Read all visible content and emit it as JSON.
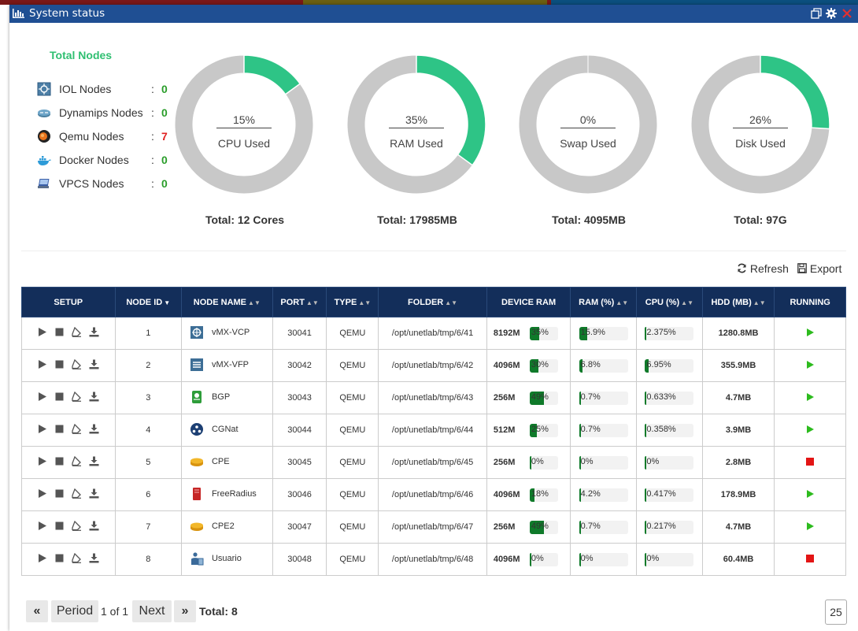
{
  "window": {
    "title": "System status"
  },
  "summary": {
    "title": "Total Nodes",
    "nodes": [
      {
        "label": "IOL Nodes",
        "count": "0",
        "icon": "iol-icon"
      },
      {
        "label": "Dynamips Nodes",
        "count": "0",
        "icon": "router-icon"
      },
      {
        "label": "Qemu Nodes",
        "count": "7",
        "icon": "qemu-icon"
      },
      {
        "label": "Docker Nodes",
        "count": "0",
        "icon": "docker-icon"
      },
      {
        "label": "VPCS Nodes",
        "count": "0",
        "icon": "vpcs-icon"
      }
    ],
    "colon": ":"
  },
  "gauges": [
    {
      "pct": "15%",
      "value": 15,
      "label": "CPU Used",
      "total": "Total: 12 Cores"
    },
    {
      "pct": "35%",
      "value": 35,
      "label": "RAM Used",
      "total": "Total: 17985MB"
    },
    {
      "pct": "0%",
      "value": 0,
      "label": "Swap Used",
      "total": "Total: 4095MB"
    },
    {
      "pct": "26%",
      "value": 26,
      "label": "Disk Used",
      "total": "Total: 97G"
    }
  ],
  "colors": {
    "accent": "#2ec486",
    "track": "#c8c8c8",
    "header": "#132e5a",
    "titlebar": "#1f4f93",
    "running": "#2dbb1e",
    "stopped": "#e31515"
  },
  "toolbar": {
    "refresh": "Refresh",
    "export": "Export"
  },
  "table": {
    "headers": [
      "SETUP",
      "NODE ID",
      "NODE NAME",
      "PORT",
      "TYPE",
      "FOLDER",
      "DEVICE RAM",
      "RAM (%)",
      "CPU (%)",
      "HDD (MB)",
      "RUNNING"
    ],
    "rows": [
      {
        "id": "1",
        "name": "vMX-VCP",
        "icon": "vmx-vcp-icon",
        "port": "30041",
        "type": "QEMU",
        "folder": "/opt/unetlab/tmp/6/41",
        "ram": "8192M",
        "dev_pct": "35%",
        "dev_val": 35,
        "ram_pct": "15.9%",
        "ram_val": 15.9,
        "cpu_pct": "2.375%",
        "cpu_val": 2.375,
        "hdd": "1280.8MB",
        "running": true
      },
      {
        "id": "2",
        "name": "vMX-VFP",
        "icon": "vmx-vfp-icon",
        "port": "30042",
        "type": "QEMU",
        "folder": "/opt/unetlab/tmp/6/42",
        "ram": "4096M",
        "dev_pct": "30%",
        "dev_val": 30,
        "ram_pct": "6.8%",
        "ram_val": 6.8,
        "cpu_pct": "6.95%",
        "cpu_val": 6.95,
        "hdd": "355.9MB",
        "running": true
      },
      {
        "id": "3",
        "name": "BGP",
        "icon": "bgp-router-icon",
        "port": "30043",
        "type": "QEMU",
        "folder": "/opt/unetlab/tmp/6/43",
        "ram": "256M",
        "dev_pct": "49%",
        "dev_val": 49,
        "ram_pct": "0.7%",
        "ram_val": 0.7,
        "cpu_pct": "0.633%",
        "cpu_val": 0.633,
        "hdd": "4.7MB",
        "running": true
      },
      {
        "id": "4",
        "name": "CGNat",
        "icon": "cgnat-icon",
        "port": "30044",
        "type": "QEMU",
        "folder": "/opt/unetlab/tmp/6/44",
        "ram": "512M",
        "dev_pct": "25%",
        "dev_val": 25,
        "ram_pct": "0.7%",
        "ram_val": 0.7,
        "cpu_pct": "0.358%",
        "cpu_val": 0.358,
        "hdd": "3.9MB",
        "running": true
      },
      {
        "id": "5",
        "name": "CPE",
        "icon": "cpe-router-icon",
        "port": "30045",
        "type": "QEMU",
        "folder": "/opt/unetlab/tmp/6/45",
        "ram": "256M",
        "dev_pct": "0%",
        "dev_val": 0,
        "ram_pct": "0%",
        "ram_val": 0,
        "cpu_pct": "0%",
        "cpu_val": 0,
        "hdd": "2.8MB",
        "running": false
      },
      {
        "id": "6",
        "name": "FreeRadius",
        "icon": "server-icon",
        "port": "30046",
        "type": "QEMU",
        "folder": "/opt/unetlab/tmp/6/46",
        "ram": "4096M",
        "dev_pct": "18%",
        "dev_val": 18,
        "ram_pct": "4.2%",
        "ram_val": 4.2,
        "cpu_pct": "0.417%",
        "cpu_val": 0.417,
        "hdd": "178.9MB",
        "running": true
      },
      {
        "id": "7",
        "name": "CPE2",
        "icon": "cpe-router-icon",
        "port": "30047",
        "type": "QEMU",
        "folder": "/opt/unetlab/tmp/6/47",
        "ram": "256M",
        "dev_pct": "49%",
        "dev_val": 49,
        "ram_pct": "0.7%",
        "ram_val": 0.7,
        "cpu_pct": "0.217%",
        "cpu_val": 0.217,
        "hdd": "4.7MB",
        "running": true
      },
      {
        "id": "8",
        "name": "Usuario",
        "icon": "user-pc-icon",
        "port": "30048",
        "type": "QEMU",
        "folder": "/opt/unetlab/tmp/6/48",
        "ram": "4096M",
        "dev_pct": "0%",
        "dev_val": 0,
        "ram_pct": "0%",
        "ram_val": 0,
        "cpu_pct": "0%",
        "cpu_val": 0,
        "hdd": "60.4MB",
        "running": false
      }
    ]
  },
  "pagination": {
    "first": "«",
    "prev": "Period",
    "page_info": "1 of 1",
    "next": "Next",
    "last": "»",
    "total": "Total: 8",
    "page_size": "25"
  }
}
